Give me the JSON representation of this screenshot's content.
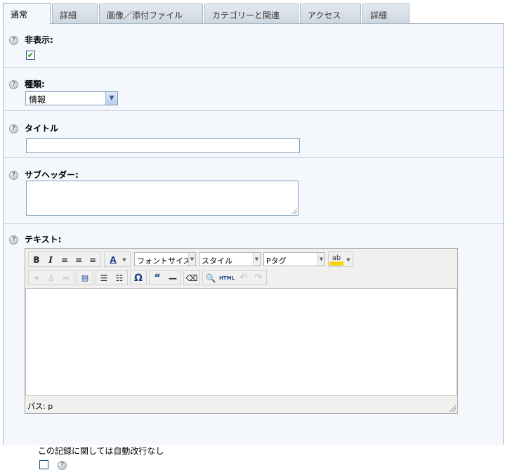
{
  "tabs": [
    {
      "label": "通常",
      "active": true
    },
    {
      "label": "詳細",
      "active": false
    },
    {
      "label": "画像／添付ファイル",
      "active": false
    },
    {
      "label": "カテゴリーと関連",
      "active": false
    },
    {
      "label": "アクセス",
      "active": false
    },
    {
      "label": "詳細",
      "active": false
    }
  ],
  "fields": {
    "hidden": {
      "label": "非表示:",
      "checked": true
    },
    "type": {
      "label": "種類:",
      "value": "情報"
    },
    "title": {
      "label": "タイトル",
      "value": ""
    },
    "subheader": {
      "label": "サブヘッダー:",
      "value": ""
    },
    "text": {
      "label": "テキスト:"
    }
  },
  "editor": {
    "bold": "B",
    "italic": "I",
    "font_size": "フォントサイズ",
    "style": "スタイル",
    "format": "Pタグ",
    "path": "パス: p",
    "html_label": "HTML"
  },
  "footer": {
    "no_linebreak_label": "この記録に関しては自動改行なし",
    "no_linebreak_checked": false
  },
  "colors": {
    "panel_bg": "#f4f7fb",
    "tab_bg": "#cfd7e1",
    "border": "#a9b8c8"
  }
}
